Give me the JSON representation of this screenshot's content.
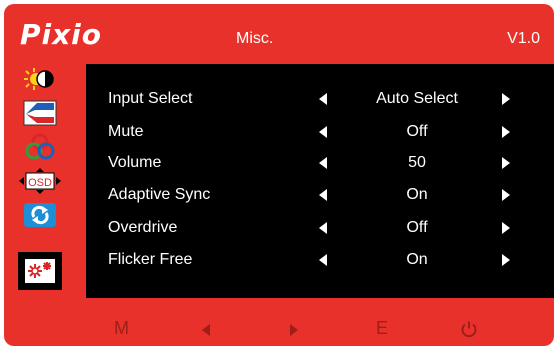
{
  "header": {
    "brand": "Pixio",
    "title": "Misc.",
    "version": "V1.0"
  },
  "sidebar": {
    "items": [
      {
        "icon": "brightness-contrast-icon"
      },
      {
        "icon": "picture-icon"
      },
      {
        "icon": "color-icon"
      },
      {
        "icon": "osd-icon",
        "text": "OSD"
      },
      {
        "icon": "reset-icon"
      },
      {
        "icon": "misc-icon",
        "selected": true
      }
    ]
  },
  "menu": {
    "items": [
      {
        "label": "Input Select",
        "value": "Auto Select"
      },
      {
        "label": "Mute",
        "value": "Off"
      },
      {
        "label": "Volume",
        "value": "50"
      },
      {
        "label": "Adaptive Sync",
        "value": "On"
      },
      {
        "label": "Overdrive",
        "value": "Off"
      },
      {
        "label": "Flicker Free",
        "value": "On"
      }
    ]
  },
  "footer": {
    "menu_key": "M",
    "left_key": "left-arrow-icon",
    "right_key": "right-arrow-icon",
    "exit_key": "E",
    "power_key": "power-icon"
  },
  "colors": {
    "frame": "#e8312b",
    "panel": "#000000",
    "footer_glyph": "#9e1f1a"
  }
}
